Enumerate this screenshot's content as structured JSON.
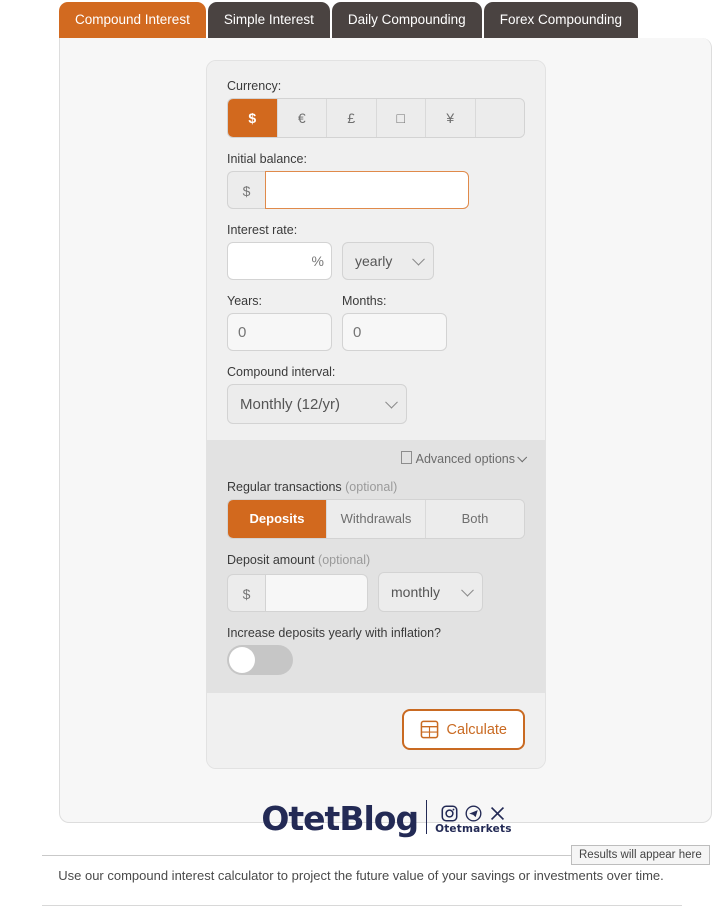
{
  "tabs": [
    {
      "label": "Compound Interest",
      "active": true
    },
    {
      "label": "Simple Interest",
      "active": false
    },
    {
      "label": "Daily Compounding",
      "active": false
    },
    {
      "label": "Forex Compounding",
      "active": false
    }
  ],
  "form": {
    "currency": {
      "label": "Currency:",
      "options": [
        "$",
        "€",
        "£",
        "□",
        "¥",
        ""
      ],
      "selected_index": 0
    },
    "initial_balance": {
      "label": "Initial balance:",
      "prefix": "$",
      "value": "",
      "placeholder": ""
    },
    "interest_rate": {
      "label": "Interest rate:",
      "value": "",
      "placeholder": "",
      "suffix": "%",
      "period_selected": "yearly"
    },
    "years": {
      "label": "Years:",
      "value": "",
      "placeholder": "0"
    },
    "months": {
      "label": "Months:",
      "value": "",
      "placeholder": "0"
    },
    "compound_interval": {
      "label": "Compound interval:",
      "selected": "Monthly (12/yr)"
    },
    "advanced_options": {
      "label": "Advanced options"
    },
    "regular_transactions": {
      "label": "Regular transactions",
      "optional_note": "(optional)",
      "options": [
        "Deposits",
        "Withdrawals",
        "Both"
      ],
      "selected_index": 0
    },
    "deposit_amount": {
      "label": "Deposit amount",
      "optional_note": "(optional)",
      "prefix": "$",
      "value": "",
      "placeholder": "",
      "frequency_selected": "monthly"
    },
    "inflation_toggle": {
      "label": "Increase deposits yearly with inflation?",
      "enabled": false
    },
    "calculate_button": {
      "label": "Calculate"
    }
  },
  "logo": {
    "brand": "OtetBlog",
    "sub_brand": "Otetmarkets",
    "social": [
      "instagram-icon",
      "telegram-icon",
      "x-icon"
    ]
  },
  "results_callout": {
    "label": "Results will appear here"
  },
  "footnote": "Use our compound interest calculator to project the future value of your savings or investments over time.",
  "colors": {
    "accent_orange": "#d2691e",
    "tab_inactive": "#4a4341",
    "brand_navy": "#232a55",
    "panel_bg": "#f0f0f0",
    "advanced_bg": "#e2e2e2"
  }
}
